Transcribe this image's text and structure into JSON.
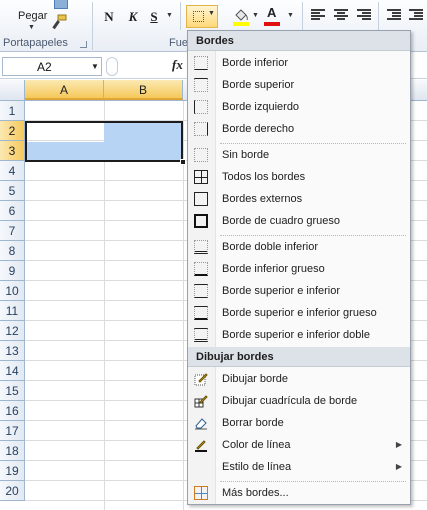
{
  "ribbon": {
    "paste_label": "Pegar",
    "clipboard_group": "Portapapeles",
    "font_group_partial": "Fue",
    "bold_label": "N",
    "italic_label": "K",
    "underline_label": "S",
    "font_color_letter": "A",
    "fill_color": "#ffff00",
    "font_color": "#e01010"
  },
  "formula_bar": {
    "name_box_value": "A2",
    "fx_label": "fx"
  },
  "grid": {
    "columns": [
      "A",
      "B"
    ],
    "rows": [
      "1",
      "2",
      "3",
      "4",
      "5",
      "6",
      "7",
      "8",
      "9",
      "10",
      "11",
      "12",
      "13",
      "14",
      "15",
      "16",
      "17",
      "18",
      "19",
      "20"
    ],
    "selected_range": "A2:B3",
    "selection_color": "#b8d4f5"
  },
  "borders_menu": {
    "section_borders": "Bordes",
    "items_borders": [
      {
        "label": "Borde inferior",
        "icon": "border-bottom-icon"
      },
      {
        "label": "Borde superior",
        "icon": "border-top-icon"
      },
      {
        "label": "Borde izquierdo",
        "icon": "border-left-icon"
      },
      {
        "label": "Borde derecho",
        "icon": "border-right-icon"
      }
    ],
    "items_general": [
      {
        "label": "Sin borde",
        "icon": "no-border-icon"
      },
      {
        "label": "Todos los bordes",
        "icon": "all-borders-icon"
      },
      {
        "label": "Bordes externos",
        "icon": "outside-borders-icon"
      },
      {
        "label": "Borde de cuadro grueso",
        "icon": "thick-box-border-icon"
      }
    ],
    "items_combo": [
      {
        "label": "Borde doble inferior",
        "icon": "double-bottom-border-icon"
      },
      {
        "label": "Borde inferior grueso",
        "icon": "thick-bottom-border-icon"
      },
      {
        "label": "Borde superior e inferior",
        "icon": "top-bottom-border-icon"
      },
      {
        "label": "Borde superior e inferior grueso",
        "icon": "top-thick-bottom-border-icon"
      },
      {
        "label": "Borde superior e inferior doble",
        "icon": "top-double-bottom-border-icon"
      }
    ],
    "section_draw": "Dibujar bordes",
    "items_draw": [
      {
        "label": "Dibujar borde",
        "icon": "draw-border-icon"
      },
      {
        "label": "Dibujar cuadrícula de borde",
        "icon": "draw-border-grid-icon"
      },
      {
        "label": "Borrar borde",
        "icon": "erase-border-icon"
      },
      {
        "label": "Color de línea",
        "icon": "line-color-icon",
        "submenu": true
      },
      {
        "label": "Estilo de línea",
        "icon": "line-style-icon",
        "submenu": true
      }
    ],
    "more_borders": "Más bordes..."
  }
}
